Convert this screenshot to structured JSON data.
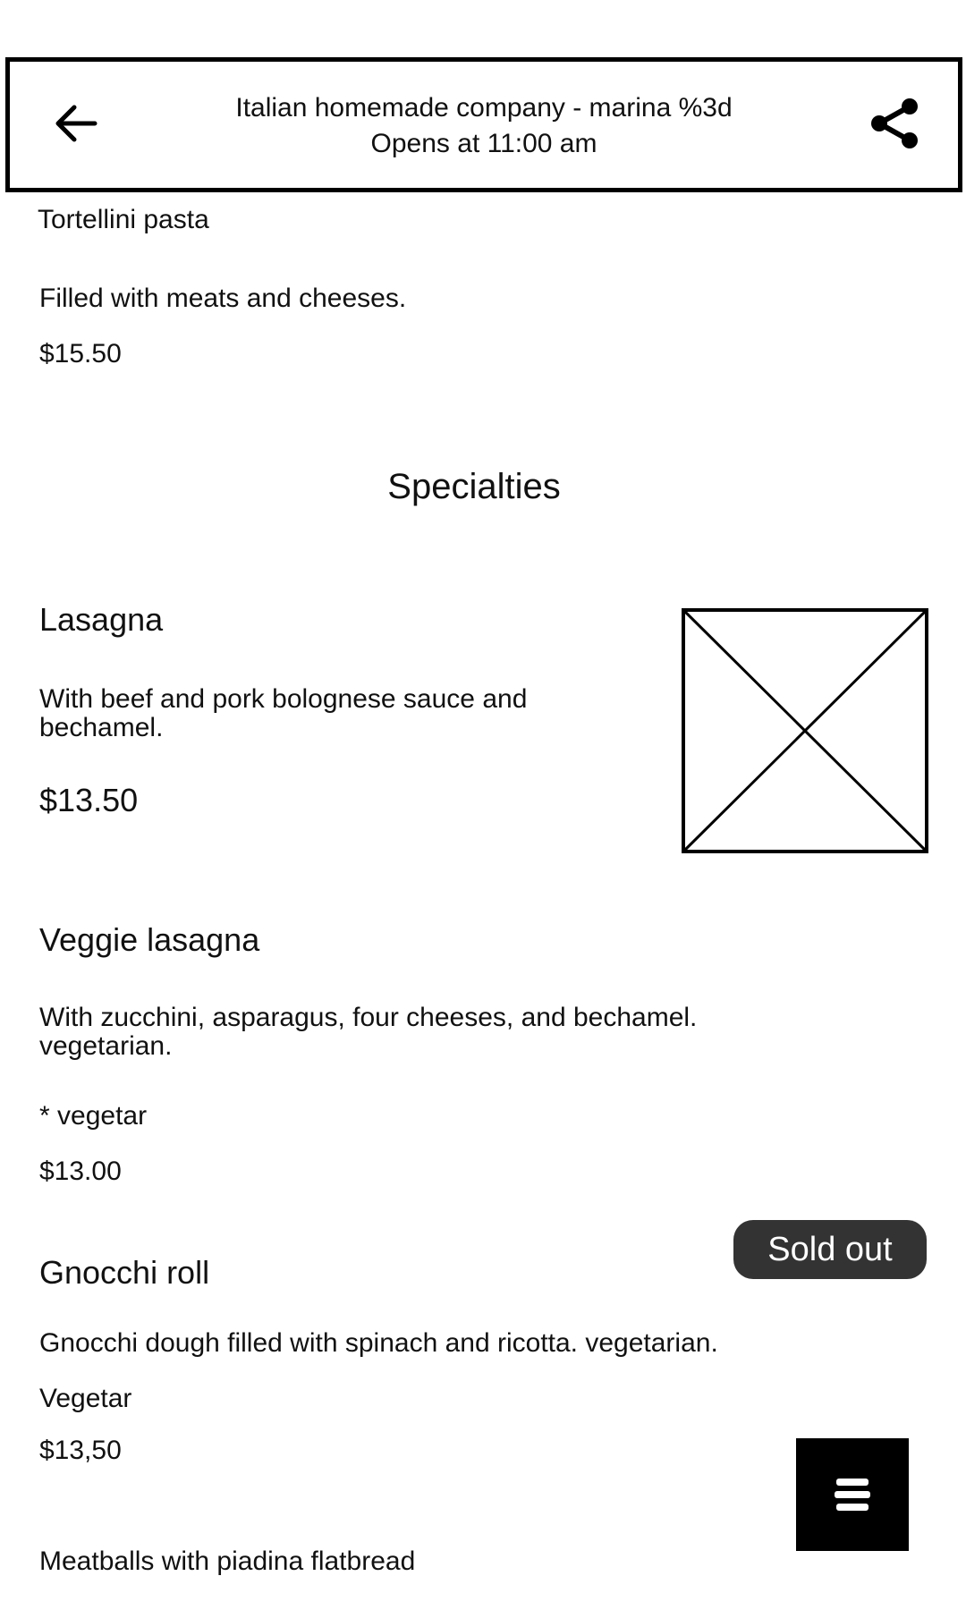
{
  "header": {
    "title": "Italian homemade company - marina %3d",
    "subtitle": "Opens at 11:00 am",
    "back_icon": "arrow-left-icon",
    "share_icon": "share-icon"
  },
  "items_top": {
    "name": "Tortellini pasta",
    "description": "Filled with meats and cheeses.",
    "price": "$15.50"
  },
  "section": {
    "title": "Specialties"
  },
  "items": [
    {
      "name": "Lasagna",
      "description_line1": "With beef and pork bolognese sauce and",
      "description_line2": "bechamel.",
      "price": "$13.50"
    },
    {
      "name": "Veggie lasagna",
      "description_line1": "With zucchini, asparagus, four cheeses, and bechamel.",
      "description_line2": "vegetarian.",
      "tag": "* vegetar",
      "price": "$13.00"
    },
    {
      "name": "Gnocchi roll",
      "description": "Gnocchi dough filled with spinach and ricotta. vegetarian.",
      "tag": "Vegetar",
      "price": "$13,50",
      "badge": "Sold out"
    },
    {
      "name": "Meatballs with piadina flatbread"
    }
  ],
  "fab": {
    "icon": "menu-icon"
  },
  "colors": {
    "badge_bg": "#333333",
    "fab_bg": "#000000",
    "border": "#000000"
  }
}
